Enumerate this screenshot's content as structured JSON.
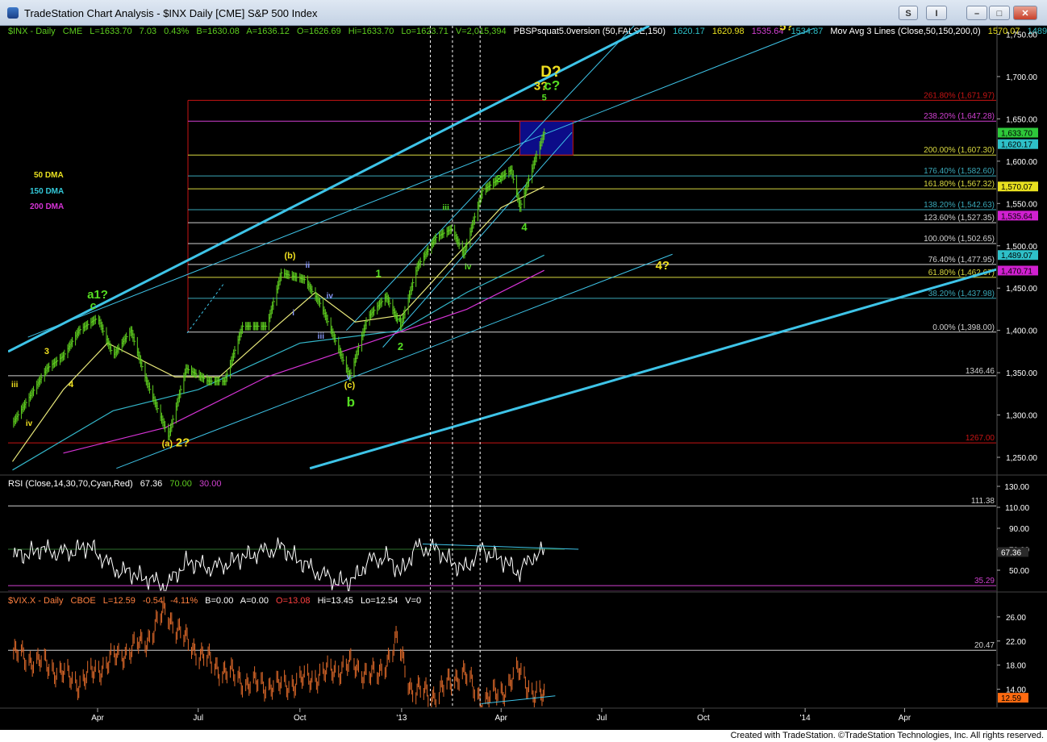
{
  "window": {
    "title": "TradeStation Chart Analysis - $INX Daily [CME] S&P 500 Index",
    "buttons": {
      "s": "S",
      "i": "I",
      "min": "–",
      "max": "□",
      "close": "✕"
    }
  },
  "colors": {
    "background": "#000000",
    "price_bars": "#5dcc1f",
    "ma50": "#e8e87a",
    "ma150": "#33b5c8",
    "ma200": "#d633d6",
    "channel": "#3ec4e8",
    "fib_red": "#c81414",
    "fib_magenta": "#d040d0",
    "fib_yellow": "#d8d840",
    "fib_cyan": "#3aa8b8",
    "fib_white": "#d0d0d0",
    "rsi_line": "#ffffff",
    "vix_bars": "#e06a2a",
    "wave_green": "#55dd22",
    "wave_yellow": "#f0e020"
  },
  "header": {
    "symbol": "$INX - Daily",
    "exchange": "CME",
    "last": "L=1633.70",
    "change": "7.03",
    "pct": "0.43%",
    "bid": "B=1630.08",
    "ask": "A=1636.12",
    "open": "O=1626.69",
    "high": "Hi=1633.70",
    "low": "Lo=1623.71",
    "volume": "V=2,015,394",
    "indicator": "PBSPsquat5.0version (50,FALSE,150)",
    "ind_v1": "1620.17",
    "ind_v2": "1620.98",
    "ind_v3": "1535.64",
    "ind_v4": "1534.87",
    "mov_avg": "Mov Avg 3 Lines (Close,50,150,200,0)",
    "ma_v1": "1570.07",
    "ma_v2": "1489"
  },
  "legend": {
    "ma50": "50 DMA",
    "ma150": "150 DMA",
    "ma200": "200 DMA"
  },
  "rsi_header": {
    "label": "RSI (Close,14,30,70,Cyan,Red)",
    "value": "67.36",
    "ob": "70.00",
    "os": "30.00"
  },
  "vix_header": {
    "symbol": "$VIX.X - Daily",
    "exchange": "CBOE",
    "last": "L=12.59",
    "change": "-0.54",
    "pct": "-4.11%",
    "bid": "B=0.00",
    "ask": "A=0.00",
    "open": "O=13.08",
    "high": "Hi=13.45",
    "low": "Lo=12.54",
    "volume": "V=0"
  },
  "footer": {
    "text": "Created with TradeStation. ©TradeStation Technologies, Inc. All rights reserved."
  },
  "chart_data": [
    {
      "type": "bar",
      "panel": "price",
      "title": "$INX - Daily",
      "ylim": [
        1230,
        1760
      ],
      "y_ticks": [
        "1,750.00",
        "1,700.00",
        "1,650.00",
        "1,600.00",
        "1,550.00",
        "1,500.00",
        "1,450.00",
        "1,400.00",
        "1,350.00",
        "1,300.00",
        "1,250.00"
      ],
      "x_ticks": [
        "Apr",
        "Jul",
        "Oct",
        "'13",
        "Apr",
        "Jul",
        "Oct",
        "'14",
        "Apr"
      ],
      "series": [
        {
          "name": "$INX",
          "points": [
            [
              "2012-01-15",
              1290
            ],
            [
              "2012-02-01",
              1325
            ],
            [
              "2012-02-15",
              1355
            ],
            [
              "2012-03-01",
              1370
            ],
            [
              "2012-03-15",
              1400
            ],
            [
              "2012-04-01",
              1415
            ],
            [
              "2012-04-15",
              1370
            ],
            [
              "2012-05-01",
              1400
            ],
            [
              "2012-05-15",
              1340
            ],
            [
              "2012-06-04",
              1275
            ],
            [
              "2012-06-20",
              1355
            ],
            [
              "2012-07-10",
              1340
            ],
            [
              "2012-07-25",
              1340
            ],
            [
              "2012-08-10",
              1405
            ],
            [
              "2012-09-01",
              1405
            ],
            [
              "2012-09-14",
              1468
            ],
            [
              "2012-10-05",
              1460
            ],
            [
              "2012-10-20",
              1430
            ],
            [
              "2012-11-15",
              1345
            ],
            [
              "2012-12-01",
              1415
            ],
            [
              "2012-12-18",
              1440
            ],
            [
              "2012-12-31",
              1405
            ],
            [
              "2013-01-15",
              1475
            ],
            [
              "2013-02-01",
              1510
            ],
            [
              "2013-02-15",
              1520
            ],
            [
              "2013-02-26",
              1490
            ],
            [
              "2013-03-15",
              1565
            ],
            [
              "2013-04-10",
              1590
            ],
            [
              "2013-04-18",
              1545
            ],
            [
              "2013-05-01",
              1600
            ],
            [
              "2013-05-10",
              1633.7
            ]
          ]
        },
        {
          "name": "50 DMA",
          "points": [
            [
              "2012-01-15",
              1245
            ],
            [
              "2012-03-01",
              1330
            ],
            [
              "2012-04-10",
              1385
            ],
            [
              "2012-06-10",
              1345
            ],
            [
              "2012-07-20",
              1345
            ],
            [
              "2012-09-01",
              1395
            ],
            [
              "2012-10-15",
              1445
            ],
            [
              "2012-11-20",
              1410
            ],
            [
              "2013-01-01",
              1418
            ],
            [
              "2013-02-10",
              1475
            ],
            [
              "2013-04-01",
              1545
            ],
            [
              "2013-05-10",
              1570.07
            ]
          ]
        },
        {
          "name": "150 DMA",
          "points": [
            [
              "2012-01-15",
              1235
            ],
            [
              "2012-04-15",
              1305
            ],
            [
              "2012-07-01",
              1330
            ],
            [
              "2012-10-01",
              1385
            ],
            [
              "2013-01-01",
              1400
            ],
            [
              "2013-03-01",
              1445
            ],
            [
              "2013-05-10",
              1489
            ]
          ]
        },
        {
          "name": "200 DMA",
          "points": [
            [
              "2012-03-01",
              1255
            ],
            [
              "2012-06-01",
              1285
            ],
            [
              "2012-09-01",
              1345
            ],
            [
              "2012-12-01",
              1385
            ],
            [
              "2013-03-01",
              1425
            ],
            [
              "2013-05-10",
              1471
            ]
          ]
        }
      ],
      "fib_levels": [
        {
          "label": "261.80% (1,671.97)",
          "value": 1671.97,
          "color": "#c81414"
        },
        {
          "label": "238.20% (1,647.28)",
          "value": 1647.28,
          "color": "#d040d0"
        },
        {
          "label": "200.00% (1,607.30)",
          "value": 1607.3,
          "color": "#d8d840"
        },
        {
          "label": "176.40% (1,582.60)",
          "value": 1582.6,
          "color": "#3aa8b8"
        },
        {
          "label": "161.80% (1,567.32)",
          "value": 1567.32,
          "color": "#d8d840"
        },
        {
          "label": "138.20% (1,542.63)",
          "value": 1542.63,
          "color": "#3aa8b8"
        },
        {
          "label": "123.60% (1,527.35)",
          "value": 1527.35,
          "color": "#d0d0d0"
        },
        {
          "label": "100.00% (1,502.65)",
          "value": 1502.65,
          "color": "#d0d0d0"
        },
        {
          "label": "76.40% (1,477.95)",
          "value": 1477.95,
          "color": "#d0d0d0"
        },
        {
          "label": "61.80% (1,462.67)",
          "value": 1462.67,
          "color": "#d8d840"
        },
        {
          "label": "38.20% (1,437.98)",
          "value": 1437.98,
          "color": "#3aa8b8"
        },
        {
          "label": "0.00% (1,398.00)",
          "value": 1398.0,
          "color": "#d0d0d0"
        }
      ],
      "horizontal_levels": [
        {
          "label": "1346.46",
          "value": 1346.46,
          "color": "#d0d0d0"
        },
        {
          "label": "1267.00",
          "value": 1267.0,
          "color": "#c81414"
        }
      ],
      "target_box": {
        "y_top": 1647.28,
        "y_bottom": 1607.3,
        "x_from": "2013-04-18",
        "x_to": "2013-06-05"
      },
      "value_tags": [
        {
          "label": "1,633.70",
          "value": 1633.7,
          "bg": "#2ec83a",
          "fg": "#000"
        },
        {
          "label": "1,620.17",
          "value": 1620.17,
          "bg": "#2ec0c8",
          "fg": "#000"
        },
        {
          "label": "1,570.07",
          "value": 1570.07,
          "bg": "#e8e020",
          "fg": "#000"
        },
        {
          "label": "1,535.64",
          "value": 1535.64,
          "bg": "#d020d0",
          "fg": "#000"
        },
        {
          "label": "1,489.07",
          "value": 1489.07,
          "bg": "#2ec0c8",
          "fg": "#000"
        },
        {
          "label": "1,470.71",
          "value": 1470.71,
          "bg": "#d020d0",
          "fg": "#000"
        }
      ],
      "wave_labels": [
        {
          "text": "a1?",
          "x": "2012-04-01",
          "y": 1438,
          "color": "#55dd22",
          "size": 15
        },
        {
          "text": "c",
          "x": "2012-03-28",
          "y": 1425,
          "color": "#55dd22",
          "size": 14
        },
        {
          "text": "3",
          "x": "2012-02-15",
          "y": 1372,
          "color": "#f0e020",
          "size": 11
        },
        {
          "text": "iii",
          "x": "2012-01-17",
          "y": 1333,
          "color": "#f0e020",
          "size": 10
        },
        {
          "text": "4",
          "x": "2012-03-08",
          "y": 1333,
          "color": "#f0e020",
          "size": 11
        },
        {
          "text": "iv",
          "x": "2012-01-30",
          "y": 1287,
          "color": "#f0e020",
          "size": 10
        },
        {
          "text": "(a)",
          "x": "2012-06-03",
          "y": 1263,
          "color": "#f0e020",
          "size": 11
        },
        {
          "text": "2?",
          "x": "2012-06-17",
          "y": 1263,
          "color": "#f0e020",
          "size": 15
        },
        {
          "text": "(b)",
          "x": "2012-09-22",
          "y": 1485,
          "color": "#f0e020",
          "size": 11
        },
        {
          "text": "ii",
          "x": "2012-10-08",
          "y": 1474,
          "color": "#8899ff",
          "size": 10
        },
        {
          "text": "i",
          "x": "2012-09-25",
          "y": 1418,
          "color": "#8899ff",
          "size": 10
        },
        {
          "text": "iv",
          "x": "2012-10-28",
          "y": 1438,
          "color": "#8899ff",
          "size": 10
        },
        {
          "text": "iii",
          "x": "2012-10-20",
          "y": 1390,
          "color": "#8899ff",
          "size": 10
        },
        {
          "text": "v",
          "x": "2012-11-14",
          "y": 1342,
          "color": "#8899ff",
          "size": 10
        },
        {
          "text": "(c)",
          "x": "2012-11-15",
          "y": 1332,
          "color": "#f0e020",
          "size": 11
        },
        {
          "text": "b",
          "x": "2012-11-16",
          "y": 1310,
          "color": "#55dd22",
          "size": 17
        },
        {
          "text": "1",
          "x": "2012-12-11",
          "y": 1463,
          "color": "#55dd22",
          "size": 13
        },
        {
          "text": "2",
          "x": "2012-12-31",
          "y": 1377,
          "color": "#55dd22",
          "size": 13
        },
        {
          "text": "ii",
          "x": "2012-12-29",
          "y": 1410,
          "color": "#55dd22",
          "size": 10
        },
        {
          "text": "iii",
          "x": "2013-02-10",
          "y": 1542,
          "color": "#55dd22",
          "size": 10
        },
        {
          "text": "iv",
          "x": "2013-03-02",
          "y": 1472,
          "color": "#55dd22",
          "size": 10
        },
        {
          "text": "3",
          "x": "2013-03-30",
          "y": 1575,
          "color": "#55dd22",
          "size": 13
        },
        {
          "text": "4",
          "x": "2013-04-22",
          "y": 1518,
          "color": "#55dd22",
          "size": 13
        },
        {
          "text": "5",
          "x": "2013-05-10",
          "y": 1672,
          "color": "#55dd22",
          "size": 11
        },
        {
          "text": "3?",
          "x": "2013-05-07",
          "y": 1684,
          "color": "#f0e020",
          "size": 15
        },
        {
          "text": "c?",
          "x": "2013-05-17",
          "y": 1684,
          "color": "#55dd22",
          "size": 17
        },
        {
          "text": "D?",
          "x": "2013-05-16",
          "y": 1700,
          "color": "#f0e020",
          "size": 19
        },
        {
          "text": "4?",
          "x": "2013-08-25",
          "y": 1472,
          "color": "#f0e020",
          "size": 15
        },
        {
          "text": "5?",
          "x": "2013-12-15",
          "y": 1755,
          "color": "#f0e020",
          "size": 15
        }
      ]
    },
    {
      "type": "line",
      "panel": "rsi",
      "title": "RSI (Close,14,30,70,Cyan,Red)",
      "ylim": [
        30,
        140
      ],
      "y_ticks": [
        "130.00",
        "110.00",
        "90.00",
        "70.00",
        "50.00"
      ],
      "levels": [
        {
          "label": "111.38",
          "value": 111.38,
          "color": "#d0d0d0"
        },
        {
          "label": "35.29",
          "value": 35.29,
          "color": "#d040d0"
        }
      ],
      "value_tag": {
        "label": "67.36",
        "value": 67.36,
        "bg": "#2a2a2a",
        "fg": "#ffffff"
      },
      "series": [
        {
          "name": "RSI",
          "points": [
            [
              "2012-01-15",
              62
            ],
            [
              "2012-02-10",
              70
            ],
            [
              "2012-03-01",
              66
            ],
            [
              "2012-03-25",
              73
            ],
            [
              "2012-04-15",
              52
            ],
            [
              "2012-05-10",
              44
            ],
            [
              "2012-06-03",
              35
            ],
            [
              "2012-06-20",
              58
            ],
            [
              "2012-07-15",
              52
            ],
            [
              "2012-08-15",
              64
            ],
            [
              "2012-09-14",
              72
            ],
            [
              "2012-10-10",
              52
            ],
            [
              "2012-11-01",
              40
            ],
            [
              "2012-11-16",
              38
            ],
            [
              "2012-12-01",
              58
            ],
            [
              "2012-12-18",
              63
            ],
            [
              "2012-12-31",
              48
            ],
            [
              "2013-01-15",
              72
            ],
            [
              "2013-02-01",
              70
            ],
            [
              "2013-02-25",
              50
            ],
            [
              "2013-03-15",
              70
            ],
            [
              "2013-04-01",
              60
            ],
            [
              "2013-04-18",
              48
            ],
            [
              "2013-05-01",
              65
            ],
            [
              "2013-05-10",
              67.36
            ]
          ]
        }
      ]
    },
    {
      "type": "bar",
      "panel": "vix",
      "title": "$VIX.X - Daily",
      "ylim": [
        11,
        30
      ],
      "y_ticks": [
        "26.00",
        "22.00",
        "18.00",
        "14.00"
      ],
      "levels": [
        {
          "label": "20.47",
          "value": 20.47,
          "color": "#d0d0d0"
        }
      ],
      "value_tag": {
        "label": "12.59",
        "value": 12.59,
        "bg": "#ff6a10",
        "fg": "#000"
      },
      "series": [
        {
          "name": "$VIX",
          "points": [
            [
              "2012-01-15",
              20
            ],
            [
              "2012-02-15",
              18
            ],
            [
              "2012-03-15",
              15
            ],
            [
              "2012-04-15",
              19
            ],
            [
              "2012-05-15",
              22
            ],
            [
              "2012-06-01",
              27
            ],
            [
              "2012-06-20",
              22
            ],
            [
              "2012-07-15",
              18
            ],
            [
              "2012-08-15",
              15
            ],
            [
              "2012-09-14",
              14.5
            ],
            [
              "2012-10-15",
              16
            ],
            [
              "2012-11-15",
              18
            ],
            [
              "2012-12-10",
              16
            ],
            [
              "2012-12-28",
              22
            ],
            [
              "2013-01-10",
              14
            ],
            [
              "2013-02-01",
              13
            ],
            [
              "2013-02-25",
              17
            ],
            [
              "2013-03-15",
              12
            ],
            [
              "2013-04-01",
              13.5
            ],
            [
              "2013-04-18",
              17
            ],
            [
              "2013-05-01",
              13
            ],
            [
              "2013-05-10",
              12.59
            ]
          ]
        }
      ]
    }
  ]
}
